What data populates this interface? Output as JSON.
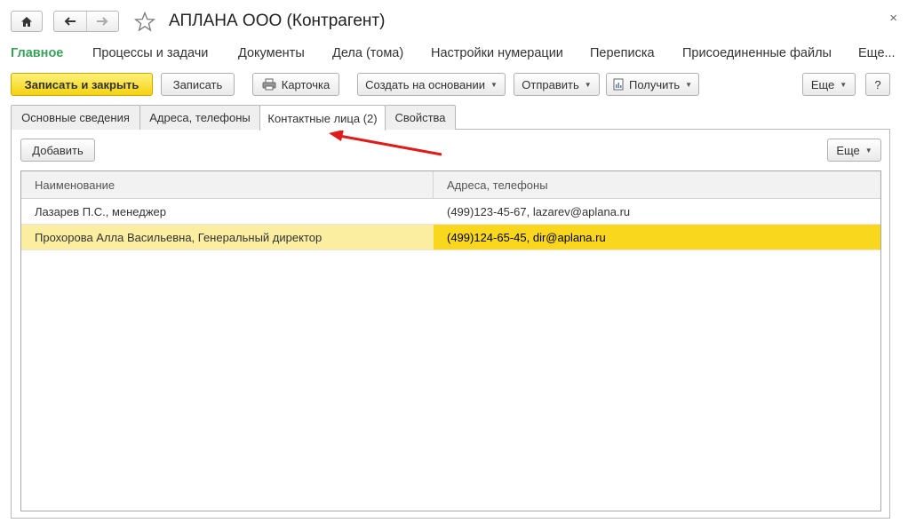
{
  "window": {
    "title": "АПЛАНА ООО (Контрагент)",
    "close_glyph": "×"
  },
  "icons": {
    "home": "home-icon",
    "back": "arrow-left-icon",
    "forward": "arrow-right-icon",
    "favorite": "star-icon",
    "print": "printer-icon",
    "receive": "document-icon",
    "annotation": "red-arrow-annotation"
  },
  "section_nav": [
    {
      "label": "Главное",
      "active": true
    },
    {
      "label": "Процессы и задачи"
    },
    {
      "label": "Документы"
    },
    {
      "label": "Дела (тома)"
    },
    {
      "label": "Настройки нумерации"
    },
    {
      "label": "Переписка"
    },
    {
      "label": "Присоединенные файлы"
    },
    {
      "label": "Еще..."
    }
  ],
  "toolbar": {
    "save_close": "Записать и закрыть",
    "save": "Записать",
    "card": "Карточка",
    "create_based": "Создать на основании",
    "send": "Отправить",
    "receive": "Получить",
    "more": "Еще",
    "help": "?"
  },
  "tabs": [
    {
      "label": "Основные сведения"
    },
    {
      "label": "Адреса, телефоны"
    },
    {
      "label": "Контактные лица (2)",
      "active": true
    },
    {
      "label": "Свойства"
    }
  ],
  "tab_toolbar": {
    "add": "Добавить",
    "more": "Еще"
  },
  "table": {
    "columns": [
      "Наименование",
      "Адреса, телефоны"
    ],
    "rows": [
      {
        "name": "Лазарев П.С., менеджер",
        "contacts": "(499)123-45-67, lazarev@aplana.ru",
        "selected": false
      },
      {
        "name": "Прохорова Алла Васильевна, Генеральный директор",
        "contacts": "(499)124-65-45, dir@aplana.ru",
        "selected": true
      }
    ]
  },
  "colors": {
    "accent_green": "#3aa15a",
    "primary_button": "#f5d211",
    "selected_row": "#f8d71c",
    "selected_row_light": "#fbeea0",
    "annotation_red": "#e01b1b"
  }
}
